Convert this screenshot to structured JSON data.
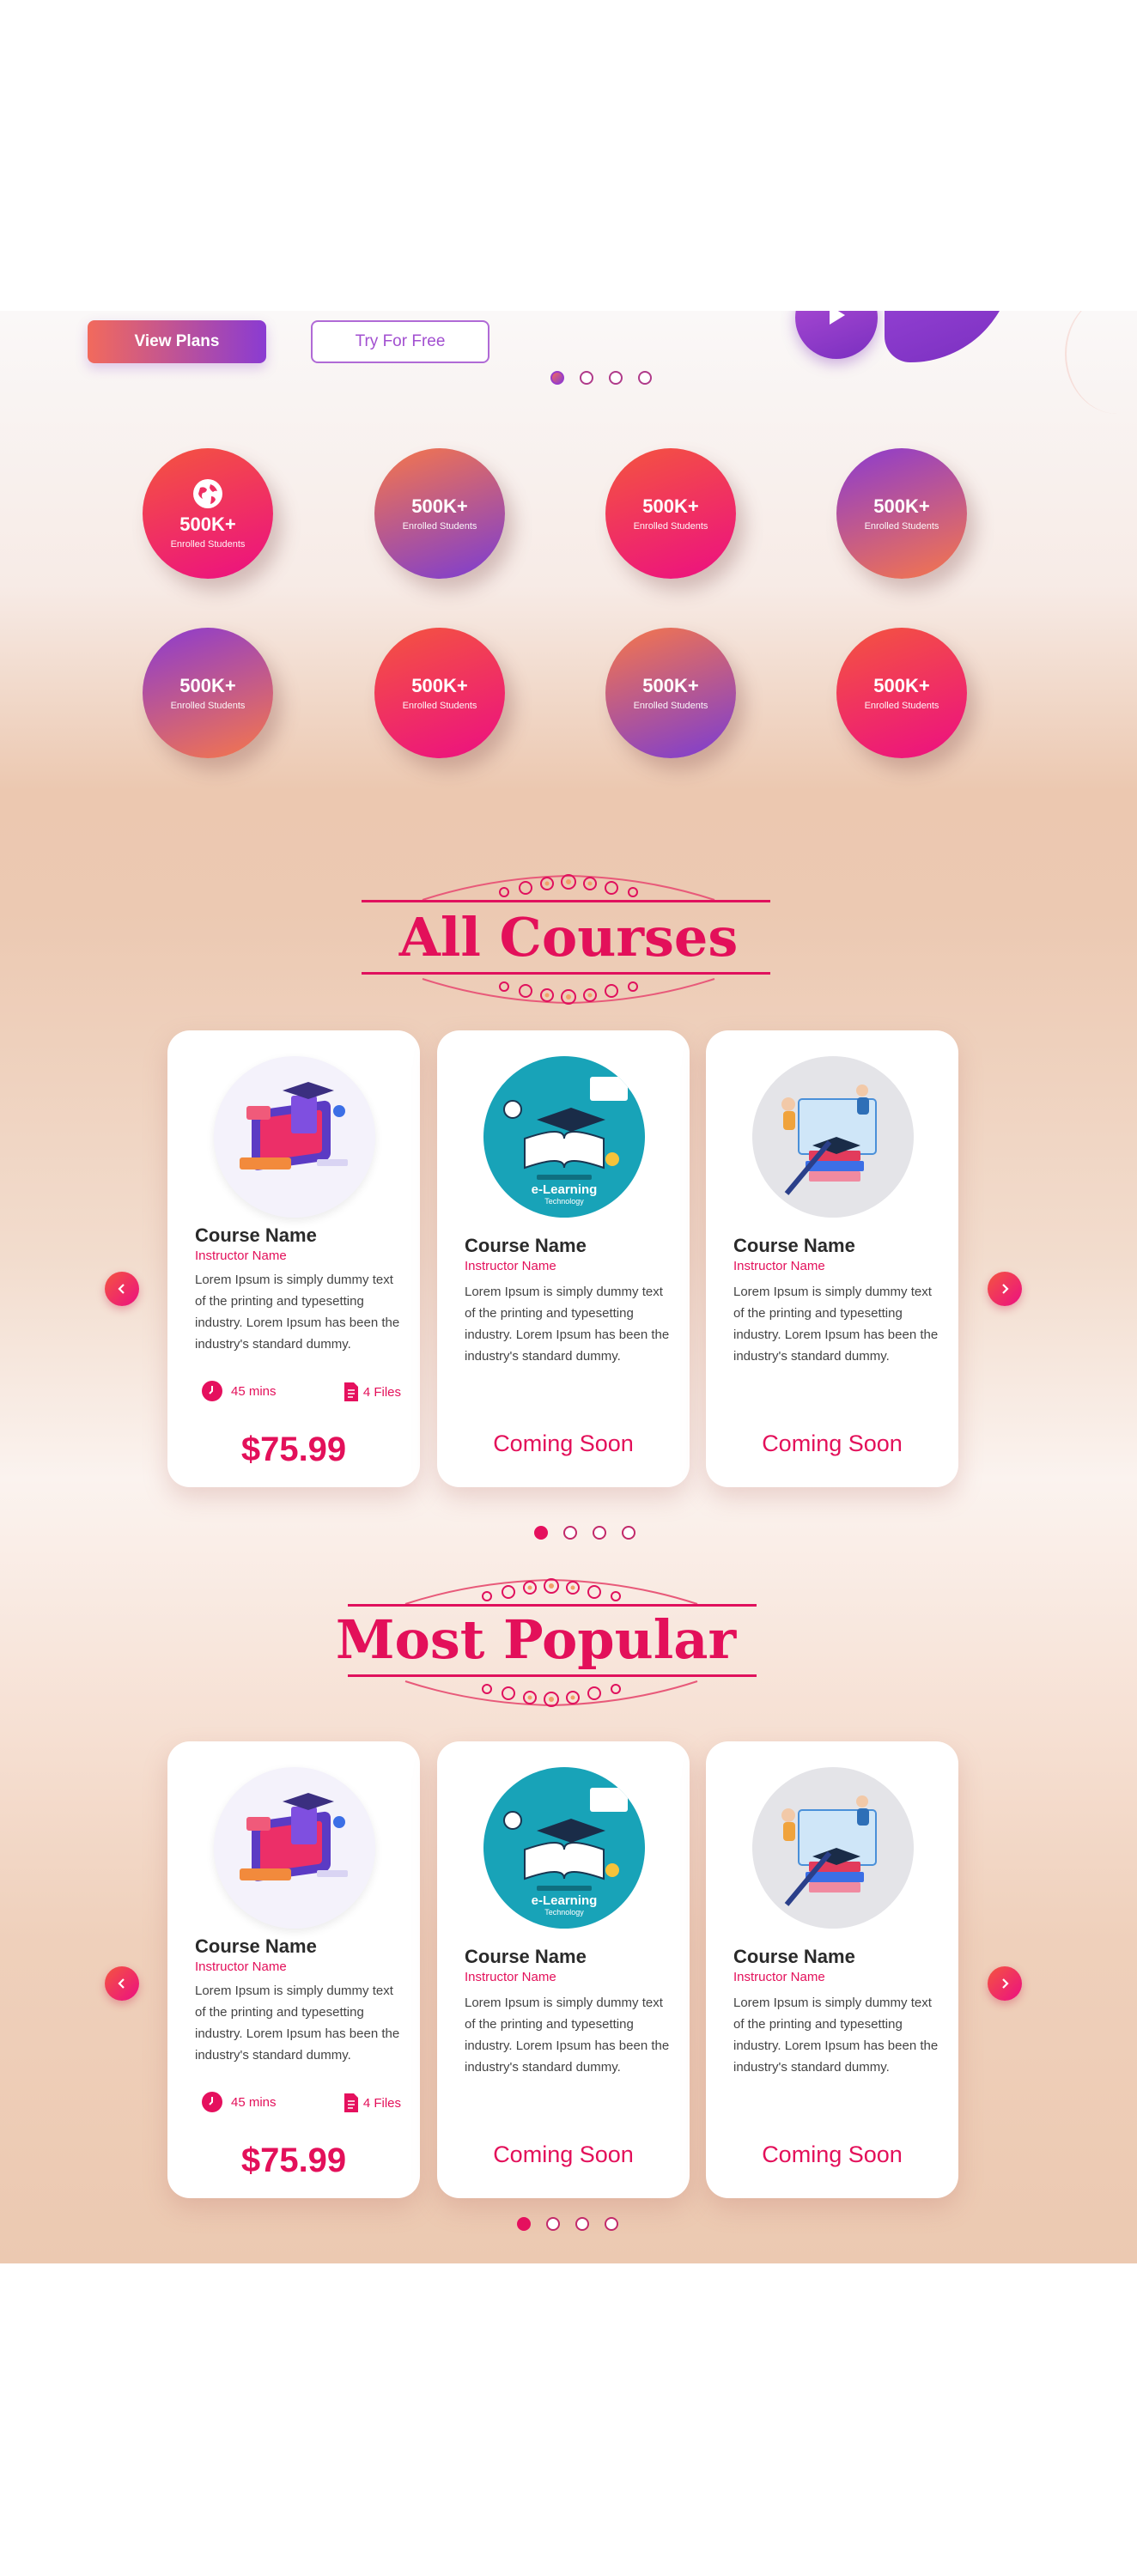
{
  "hero": {
    "view_plans_label": "View Plans",
    "try_free_label": "Try For Free",
    "dots_count": 4,
    "active_dot": 0
  },
  "stats": [
    {
      "value": "500K+",
      "label": "Enrolled Students",
      "icon": "globe-icon"
    },
    {
      "value": "500K+",
      "label": "Enrolled Students"
    },
    {
      "value": "500K+",
      "label": "Enrolled Students"
    },
    {
      "value": "500K+",
      "label": "Enrolled Students"
    },
    {
      "value": "500K+",
      "label": "Enrolled Students"
    },
    {
      "value": "500K+",
      "label": "Enrolled Students"
    },
    {
      "value": "500K+",
      "label": "Enrolled Students"
    },
    {
      "value": "500K+",
      "label": "Enrolled Students"
    }
  ],
  "all_courses": {
    "title": "All Courses",
    "cards": [
      {
        "course_name": "Course Name",
        "instructor": "Instructor Name",
        "description": "Lorem Ipsum is simply dummy text of the printing and typesetting industry. Lorem Ipsum has been the industry's standard dummy.",
        "duration": "45 mins",
        "files": "4 Files",
        "price": "$75.99",
        "image": "isometric-learning-illustration"
      },
      {
        "course_name": "Course Name",
        "instructor": "Instructor Name",
        "description": "Lorem Ipsum is simply dummy text of the printing and typesetting industry. Lorem Ipsum has been the industry's standard dummy.",
        "status": "Coming Soon",
        "image": "e-learning-technology-illustration",
        "image_caption": "e-Learning",
        "image_subcaption": "Technology"
      },
      {
        "course_name": "Course Name",
        "instructor": "Instructor Name",
        "description": "Lorem Ipsum is simply dummy text of the printing and typesetting industry. Lorem Ipsum has been the industry's standard dummy.",
        "status": "Coming Soon",
        "image": "graduation-books-illustration"
      }
    ],
    "active_dot": 0
  },
  "most_popular": {
    "title": "Most Popular",
    "cards": [
      {
        "course_name": "Course Name",
        "instructor": "Instructor Name",
        "description": "Lorem Ipsum is simply dummy text of the printing and typesetting industry. Lorem Ipsum has been the industry's standard dummy.",
        "duration": "45 mins",
        "files": "4 Files",
        "price": "$75.99",
        "image": "isometric-learning-illustration"
      },
      {
        "course_name": "Course Name",
        "instructor": "Instructor Name",
        "description": "Lorem Ipsum is simply dummy text of the printing and typesetting industry. Lorem Ipsum has been the industry's standard dummy.",
        "status": "Coming Soon",
        "image": "e-learning-technology-illustration",
        "image_caption": "e-Learning",
        "image_subcaption": "Technology"
      },
      {
        "course_name": "Course Name",
        "instructor": "Instructor Name",
        "description": "Lorem Ipsum is simply dummy text of the printing and typesetting industry. Lorem Ipsum has been the industry's standard dummy.",
        "status": "Coming Soon",
        "image": "graduation-books-illustration"
      }
    ],
    "active_dot": 0
  },
  "colors": {
    "accent": "#e3105a",
    "purple": "#8a3bd2",
    "orange": "#f26a5c"
  }
}
